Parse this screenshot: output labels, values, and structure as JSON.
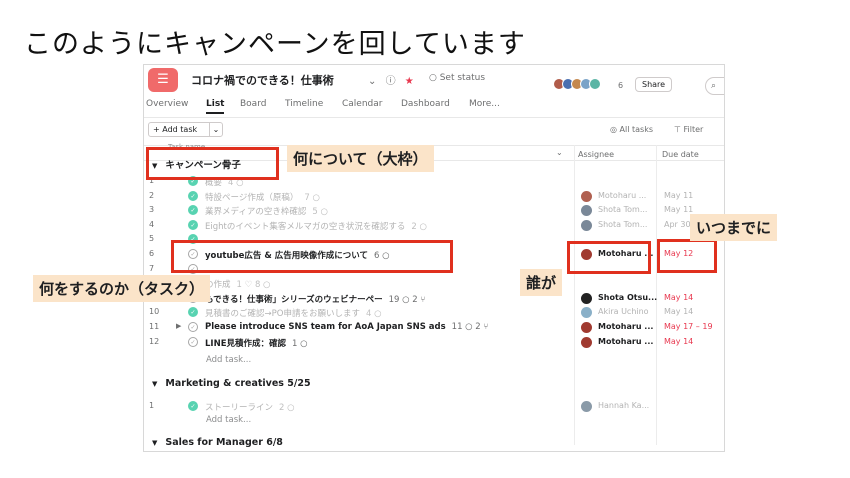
{
  "slide_title": "このようにキャンペーンを回しています",
  "app": {
    "logo_glyph": "☰",
    "project_title": "コロナ禍でのできる！仕事術",
    "title_chevron": "⌄",
    "info_icon": "ⓘ",
    "star_icon": "★",
    "set_status": "○ Set status",
    "avatar_colors": [
      "#b05c4a",
      "#4a6fb0",
      "#c4884e",
      "#7aa3c8",
      "#5bb5a5"
    ],
    "member_count": "6",
    "share_label": "Share",
    "search_glyph": "⌕",
    "accent_color": "#f06a6a",
    "complete_color": "#58d3b1",
    "overdue_color": "#e8384f"
  },
  "tabs": [
    {
      "label": "Overview",
      "active": false
    },
    {
      "label": "List",
      "active": true
    },
    {
      "label": "Board",
      "active": false
    },
    {
      "label": "Timeline",
      "active": false
    },
    {
      "label": "Calendar",
      "active": false
    },
    {
      "label": "Dashboard",
      "active": false
    },
    {
      "label": "More...",
      "active": false
    }
  ],
  "toolbar": {
    "add_task": "+ Add task",
    "add_task_dropdown": "⌄",
    "all_tasks": "◎ All tasks",
    "filter": "⊤ Filter"
  },
  "columns": {
    "task": "Task name",
    "chevron": "⌄",
    "assignee": "Assignee",
    "due": "Due date"
  },
  "sections": [
    {
      "tri": "▼",
      "title": "キャンペーン骨子"
    },
    {
      "tri": "▼",
      "title": "Marketing & creatives 5/25"
    },
    {
      "tri": "▼",
      "title": "Sales for Manager 6/8"
    }
  ],
  "rows_campaign": [
    {
      "num": "1",
      "done": true,
      "name": "概要",
      "meta": "4 ○",
      "faded": true,
      "bold": false,
      "assignee": "",
      "due": "",
      "due_red": false,
      "av_color": "",
      "expander": ""
    },
    {
      "num": "2",
      "done": true,
      "name": "特設ページ作成（原稿）",
      "meta": "7 ○",
      "faded": true,
      "bold": false,
      "assignee": "Motoharu ...",
      "due": "May 11",
      "due_red": false,
      "av_color": "#b06050",
      "expander": ""
    },
    {
      "num": "3",
      "done": true,
      "name": "業界メディアの空き枠確認",
      "meta": "5 ○",
      "faded": true,
      "bold": false,
      "assignee": "Shota Tom...",
      "due": "May 11",
      "due_red": false,
      "av_color": "#7a8898",
      "expander": ""
    },
    {
      "num": "4",
      "done": true,
      "name": "Eightのイベント集客メルマガの空き状況を確認する",
      "meta": "2 ○",
      "faded": true,
      "bold": false,
      "assignee": "Shota Tom...",
      "due": "Apr 30",
      "due_red": false,
      "av_color": "#7a8898",
      "expander": ""
    },
    {
      "num": "5",
      "done": true,
      "name": "",
      "meta": "",
      "faded": true,
      "bold": false,
      "assignee": "",
      "due": "",
      "due_red": false,
      "av_color": "",
      "expander": ""
    },
    {
      "num": "6",
      "done": false,
      "name": "youtube広告 & 広告用映像作成について",
      "meta": "6 ○",
      "faded": false,
      "bold": true,
      "assignee": "Motoharu ...",
      "due": "May 12",
      "due_red": true,
      "av_color": "#a03a30",
      "expander": ""
    },
    {
      "num": "7",
      "done": false,
      "name": "",
      "meta": "",
      "faded": true,
      "bold": false,
      "assignee": "",
      "due": "",
      "due_red": false,
      "av_color": "",
      "expander": ""
    },
    {
      "num": "8",
      "done": true,
      "name": "の作成",
      "meta": "1 ♡ 8 ○",
      "faded": true,
      "bold": false,
      "assignee": "",
      "due": "",
      "due_red": false,
      "av_color": "",
      "expander": ""
    },
    {
      "num": "9",
      "done": false,
      "name": "もできる！仕事術」シリーズのウェビナーペー",
      "meta": "19 ○ 2 ⑂",
      "faded": false,
      "bold": true,
      "assignee": "Shota Otsu...",
      "due": "May 14",
      "due_red": true,
      "av_color": "#222222",
      "expander": ""
    },
    {
      "num": "10",
      "done": true,
      "name": "見積書のご確認→PO申請をお願いします",
      "meta": "4 ○",
      "faded": true,
      "bold": false,
      "assignee": "Akira Uchino",
      "due": "May 14",
      "due_red": false,
      "av_color": "#8ab0c8",
      "expander": ""
    },
    {
      "num": "11",
      "done": false,
      "name": "Please introduce SNS team for AoA Japan SNS ads",
      "meta": "11 ○ 2 ⑂",
      "faded": false,
      "bold": true,
      "assignee": "Motoharu ...",
      "due": "May 17 – 19",
      "due_red": true,
      "av_color": "#a03a30",
      "expander": "▶"
    },
    {
      "num": "12",
      "done": false,
      "name": "LINE見積作成：確認",
      "meta": "1 ○",
      "faded": false,
      "bold": true,
      "assignee": "Motoharu ...",
      "due": "May 14",
      "due_red": true,
      "av_color": "#a03a30",
      "expander": ""
    }
  ],
  "add_task_row": "Add task...",
  "rows_marketing": [
    {
      "num": "1",
      "done": true,
      "name": "ストーリーライン",
      "meta": "2 ○",
      "faded": true,
      "bold": false,
      "assignee": "Hannah Ka...",
      "due": "",
      "due_red": false,
      "av_color": "#8a9aa8",
      "expander": ""
    }
  ],
  "annotations": {
    "what_about": "何について（大枠）",
    "what_to_do": "何をするのか（タスク）",
    "who": "誰が",
    "by_when": "いつまでに",
    "box_color": "#e0301e",
    "label_color": "#fbe4c9"
  }
}
